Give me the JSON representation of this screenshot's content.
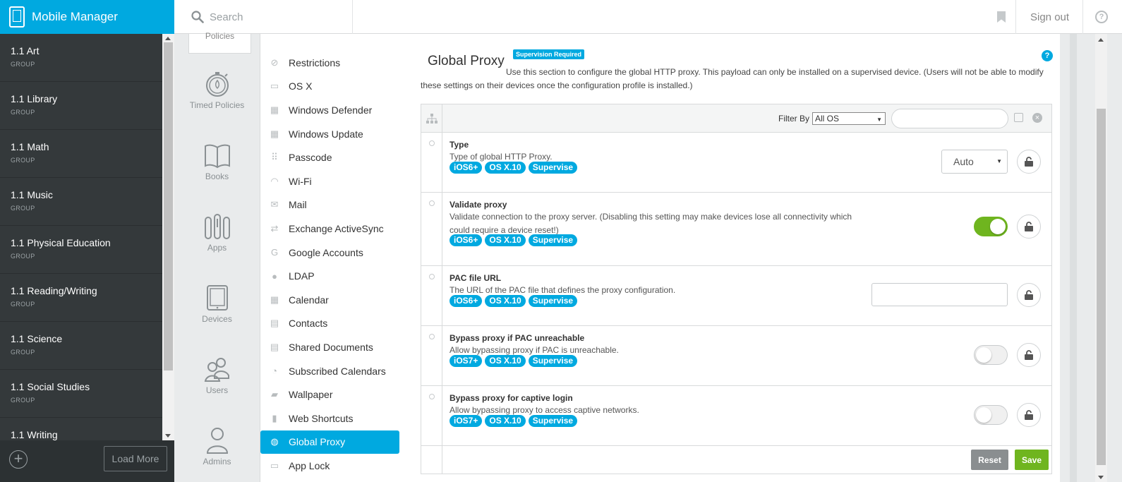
{
  "app": {
    "title": "Mobile Manager"
  },
  "search": {
    "placeholder": "Search"
  },
  "header": {
    "signout_label": "Sign out",
    "help_symbol": "?"
  },
  "groups": {
    "items": [
      {
        "name": "1.1 Art",
        "kind": "GROUP"
      },
      {
        "name": "1.1 Library",
        "kind": "GROUP"
      },
      {
        "name": "1.1 Math",
        "kind": "GROUP"
      },
      {
        "name": "1.1 Music",
        "kind": "GROUP"
      },
      {
        "name": "1.1 Physical Education",
        "kind": "GROUP"
      },
      {
        "name": "1.1 Reading/Writing",
        "kind": "GROUP"
      },
      {
        "name": "1.1 Science",
        "kind": "GROUP"
      },
      {
        "name": "1.1 Social Studies",
        "kind": "GROUP"
      },
      {
        "name": "1.1 Writing",
        "kind": "GROUP"
      }
    ],
    "add_symbol": "+",
    "load_more_label": "Load More"
  },
  "rail": {
    "active_label": "Policies",
    "items": [
      {
        "label": "Timed Policies",
        "icon": "stopwatch-icon"
      },
      {
        "label": "Books",
        "icon": "book-icon"
      },
      {
        "label": "Apps",
        "icon": "apps-icon"
      },
      {
        "label": "Devices",
        "icon": "tablet-icon"
      },
      {
        "label": "Users",
        "icon": "users-icon"
      },
      {
        "label": "Admins",
        "icon": "admin-icon"
      }
    ]
  },
  "payloads": {
    "items": [
      {
        "label": "Restrictions",
        "glyph": "⊘"
      },
      {
        "label": "OS X",
        "glyph": "▭"
      },
      {
        "label": "Windows Defender",
        "glyph": "▦"
      },
      {
        "label": "Windows Update",
        "glyph": "▦"
      },
      {
        "label": "Passcode",
        "glyph": "⠿"
      },
      {
        "label": "Wi-Fi",
        "glyph": "◠"
      },
      {
        "label": "Mail",
        "glyph": "✉"
      },
      {
        "label": "Exchange ActiveSync",
        "glyph": "⇄"
      },
      {
        "label": "Google Accounts",
        "glyph": "G"
      },
      {
        "label": "LDAP",
        "glyph": "●"
      },
      {
        "label": "Calendar",
        "glyph": "▦"
      },
      {
        "label": "Contacts",
        "glyph": "▤"
      },
      {
        "label": "Shared Documents",
        "glyph": "▤"
      },
      {
        "label": "Subscribed Calendars",
        "glyph": "◔"
      },
      {
        "label": "Wallpaper",
        "glyph": "▰"
      },
      {
        "label": "Web Shortcuts",
        "glyph": "▮"
      },
      {
        "label": "Global Proxy",
        "glyph": "◍",
        "active": true
      },
      {
        "label": "App Lock",
        "glyph": "▭"
      }
    ]
  },
  "page": {
    "title": "Global Proxy",
    "badge": "Supervision Required",
    "help_symbol": "?",
    "description": "Use this section to configure the global HTTP proxy. This payload can only be installed on a supervised device. (Users will not be able to modify these settings on their devices once the configuration profile is installed.)"
  },
  "filter": {
    "label": "Filter By",
    "selected": "All OS",
    "clear_symbol": "×"
  },
  "settings": [
    {
      "title": "Type",
      "description": "Type of global HTTP Proxy.",
      "tags": [
        "iOS6+",
        "OS X.10",
        "Supervise"
      ],
      "control": "dropdown",
      "value": "Auto"
    },
    {
      "title": "Validate proxy",
      "description": "Validate connection to the proxy server. (Disabling this setting may make devices lose all connectivity which could require a device reset!)",
      "tags": [
        "iOS6+",
        "OS X.10",
        "Supervise"
      ],
      "control": "toggle",
      "value": true
    },
    {
      "title": "PAC file URL",
      "description": "The URL of the PAC file that defines the proxy configuration.",
      "tags": [
        "iOS6+",
        "OS X.10",
        "Supervise"
      ],
      "control": "text",
      "value": ""
    },
    {
      "title": "Bypass proxy if PAC unreachable",
      "description": "Allow bypassing proxy if PAC is unreachable.",
      "tags": [
        "iOS7+",
        "OS X.10",
        "Supervise"
      ],
      "control": "toggle",
      "value": false
    },
    {
      "title": "Bypass proxy for captive login",
      "description": "Allow bypassing proxy to access captive networks.",
      "tags": [
        "iOS7+",
        "OS X.10",
        "Supervise"
      ],
      "control": "toggle",
      "value": false
    }
  ],
  "actions": {
    "reset_label": "Reset",
    "save_label": "Save"
  },
  "colors": {
    "accent": "#00a9e0",
    "sidebar": "#34393b",
    "toggle_on": "#6fb51f",
    "reset": "#8a8e90",
    "save": "#6fb51f"
  }
}
